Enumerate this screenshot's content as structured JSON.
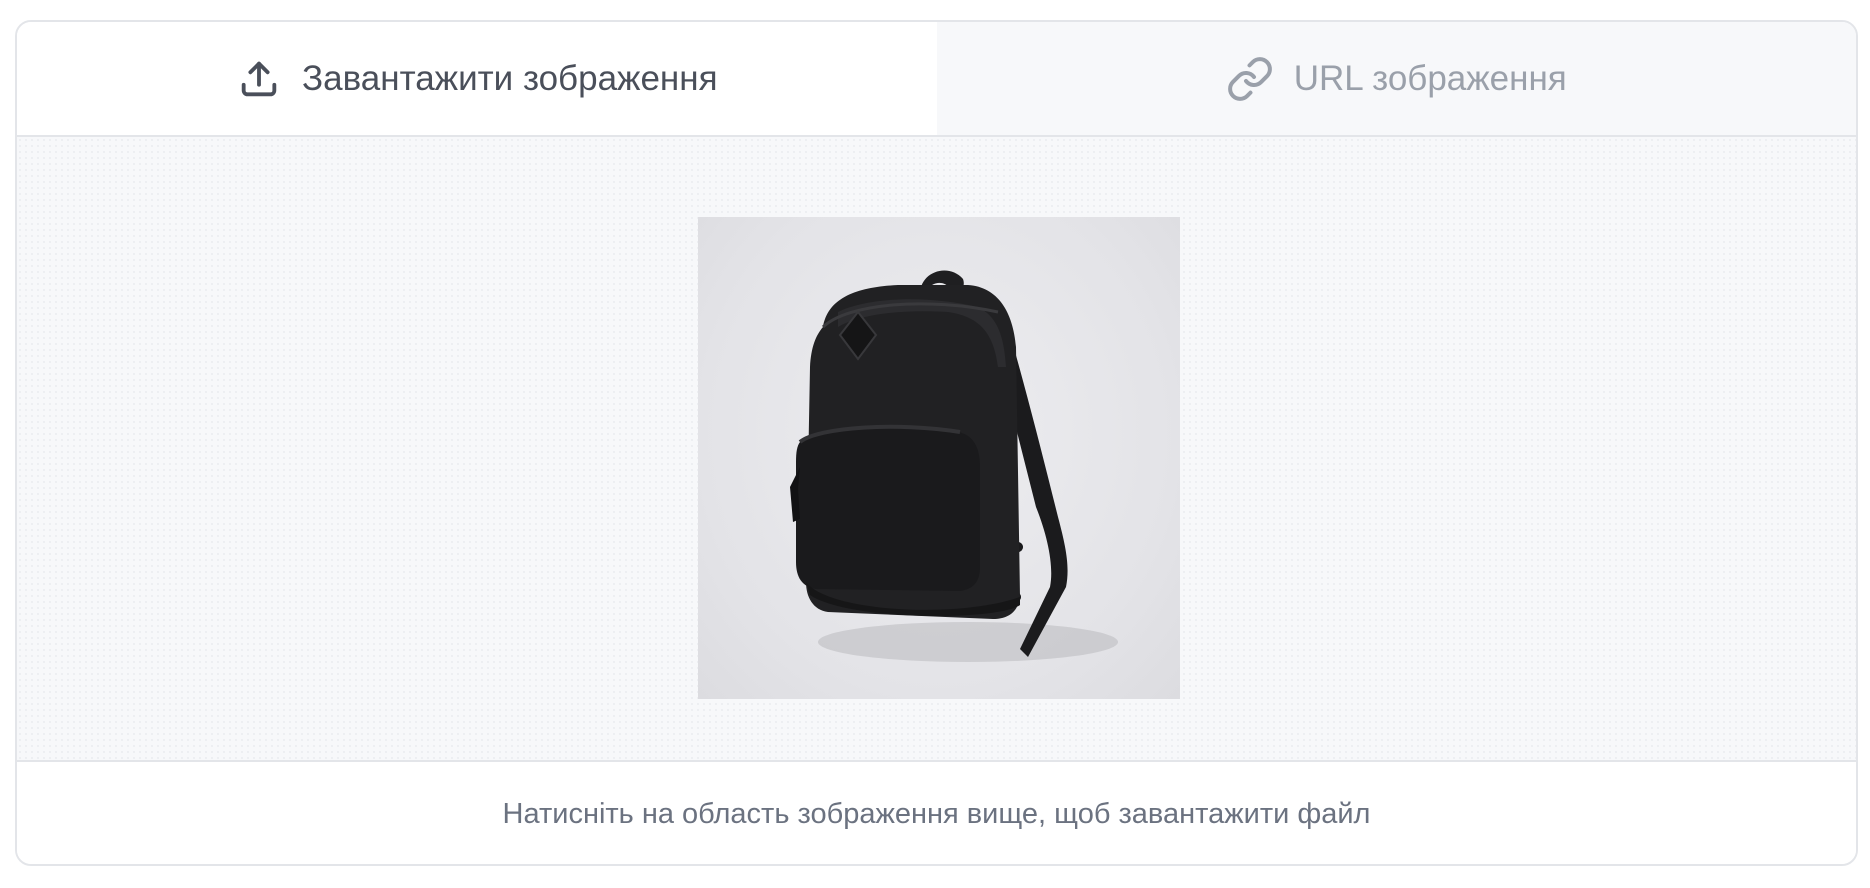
{
  "tabs": [
    {
      "label": "Завантажити зображення",
      "icon": "upload-icon",
      "active": true
    },
    {
      "label": "URL зображення",
      "icon": "link-icon",
      "active": false
    }
  ],
  "dropzone": {
    "preview": "backpack-image"
  },
  "footer": {
    "hint": "Натисніть на область зображення вище, щоб завантажити файл"
  },
  "colors": {
    "active_tab_text": "#4a4f5a",
    "inactive_tab_text": "#9aa0aa",
    "border": "#e3e5e9",
    "dropzone_bg": "#f7f8fa"
  }
}
